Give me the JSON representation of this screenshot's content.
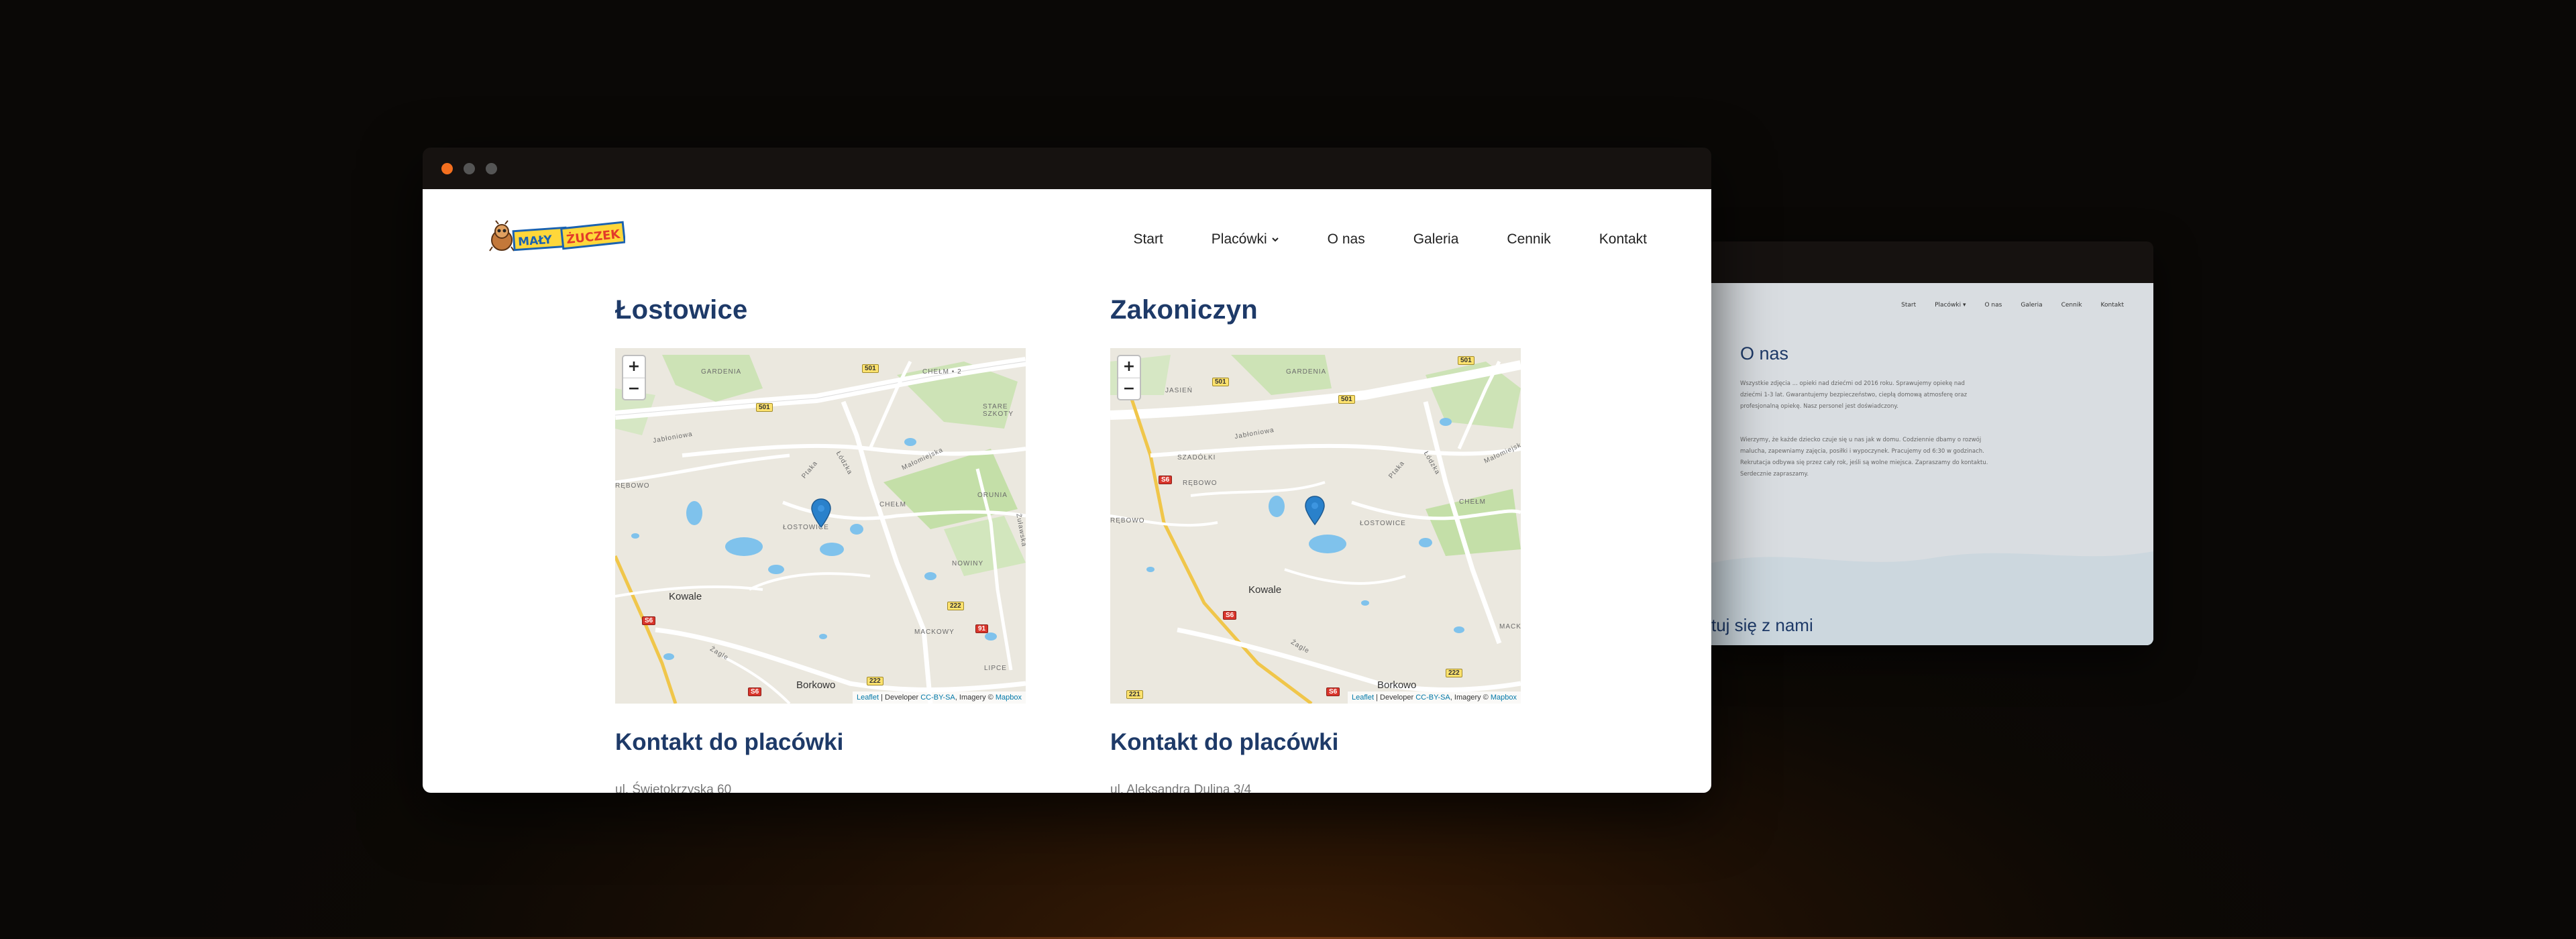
{
  "back_window": {
    "nav": [
      "Start",
      "Placówki ▾",
      "O nas",
      "Galeria",
      "Cennik",
      "Kontakt"
    ],
    "title": "O nas",
    "paragraph1": "Wszystkie zdjęcia ... opieki nad dziećmi od 2016 roku. Sprawujemy opiekę nad dziećmi 1-3 lat. Gwarantujemy bezpieczeństwo, ciepłą domową atmosferę oraz profesjonalną opiekę. Nasz personel jest doświadczony.",
    "paragraph2": "Wierzymy, że każde dziecko czuje się u nas jak w domu. Codziennie dbamy o rozwój malucha, zapewniamy zajęcia, posiłki i wypoczynek. Pracujemy od 6:30 w godzinach. Rekrutacja odbywa się przez cały rok, jeśli są wolne miejsca. Zapraszamy do kontaktu. Serdecznie zapraszamy.",
    "contact_heading": "ktuj się z nami"
  },
  "header": {
    "logo_text": "MAŁY ŻUCZEK",
    "nav": {
      "start": "Start",
      "placowki": "Placówki",
      "o_nas": "O nas",
      "galeria": "Galeria",
      "cennik": "Cennik",
      "kontakt": "Kontakt"
    }
  },
  "locations": [
    {
      "name": "Łostowice",
      "zoom_in": "+",
      "zoom_out": "−",
      "attribution": {
        "leaflet": "Leaflet",
        "dev": " | Developer ",
        "license": "CC-BY-SA",
        "imagery": ", Imagery © ",
        "mapbox": "Mapbox"
      },
      "contact_title": "Kontakt do placówki",
      "address": "ul. Świętokrzyska 60"
    },
    {
      "name": "Zakoniczyn",
      "zoom_in": "+",
      "zoom_out": "−",
      "attribution": {
        "leaflet": "Leaflet",
        "dev": " | Developer ",
        "license": "CC-BY-SA",
        "imagery": ", Imagery © ",
        "mapbox": "Mapbox"
      },
      "contact_title": "Kontakt do placówki",
      "address": "ul. Aleksandra Dulina 3/4"
    }
  ],
  "map_labels_left": {
    "oliwa": "GARDENIA",
    "chelm": "CHEŁM • 2",
    "stare_szkoty": "STARE SZKOTY",
    "jablon": "Jabłoniowa",
    "ptaka": "Ptaka",
    "lodzka": "Łódzka",
    "malomiejska": "Małomiejska",
    "bodolki": "RĘBOWO",
    "chelm_c": "CHEŁM",
    "orunia": "ORUNIA",
    "lostowice": "ŁOSTOWICE",
    "zulawska": "Żuławska",
    "nowiny": "NOWINY",
    "kowale": "Kowale",
    "mackowy": "MACKOWY",
    "lipce": "LIPCE",
    "borkowo": "Borkowo",
    "zagle": "Żagle"
  },
  "map_labels_right": {
    "jasien": "JASIEŃ",
    "gardenia": "GARDENIA",
    "szadolki": "SZADÓŁKI",
    "rebowo": "RĘBOWO",
    "jablon": "Jabłoniowa",
    "ptaka": "Ptaka",
    "lodzka": "Łódzka",
    "malomiejska": "Małomiejska",
    "rebowo2": "RĘBOWO",
    "chelm": "CHEŁM",
    "lostowice": "ŁOSTOWICE",
    "kowale": "Kowale",
    "borkowo": "Borkowo",
    "zagle": "Żagle",
    "mack": "MACK"
  },
  "colors": {
    "accent_blue": "#1e3a68",
    "traffic_orange": "#f36f1f",
    "marker_blue": "#2a81cb"
  }
}
